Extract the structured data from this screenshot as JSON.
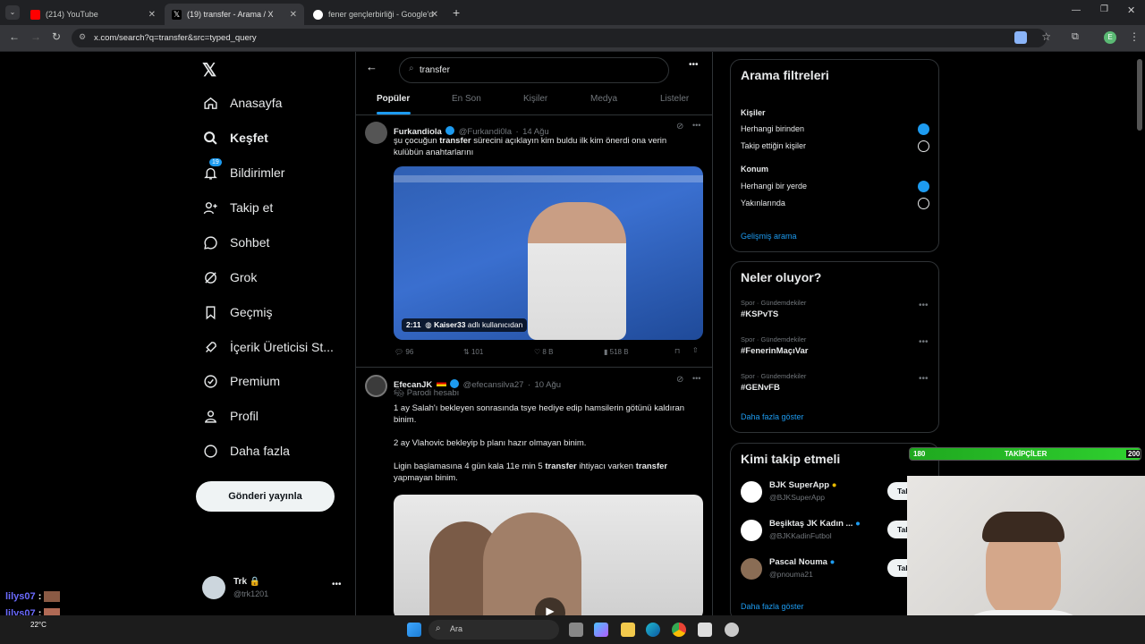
{
  "browser": {
    "tabs": [
      {
        "label": "(214) YouTube",
        "color": "#ff0000"
      },
      {
        "label": "(19) transfer - Arama / X",
        "color": "#ffffff"
      },
      {
        "label": "fener gençlerbirliği - Google'da",
        "color": "#4285f4"
      }
    ],
    "url": "x.com/search?q=transfer&src=typed_query",
    "profile_letter": "E"
  },
  "nav": {
    "items": [
      {
        "label": "Anasayfa",
        "icon": "home-icon"
      },
      {
        "label": "Keşfet",
        "icon": "search-icon"
      },
      {
        "label": "Bildirimler",
        "icon": "bell-icon",
        "badge": "19"
      },
      {
        "label": "Takip et",
        "icon": "add-user-icon"
      },
      {
        "label": "Sohbet",
        "icon": "chat-icon"
      },
      {
        "label": "Grok",
        "icon": "grok-icon"
      },
      {
        "label": "Geçmiş",
        "icon": "bookmark-icon"
      },
      {
        "label": "İçerik Üreticisi St...",
        "icon": "rocket-icon"
      },
      {
        "label": "Premium",
        "icon": "verified-icon"
      },
      {
        "label": "Profil",
        "icon": "person-icon"
      },
      {
        "label": "Daha fazla",
        "icon": "more-circle-icon"
      }
    ],
    "post_button": "Gönderi yayınla",
    "account": {
      "name": "Trk",
      "handle": "@trk1201"
    }
  },
  "search": {
    "query": "transfer",
    "tabs": [
      "Popüler",
      "En Son",
      "Kişiler",
      "Medya",
      "Listeler"
    ],
    "active_tab": "Popüler"
  },
  "tweets": [
    {
      "name": "Furkandiola",
      "handle": "@Furkandi0la",
      "date": "14 Ağu",
      "text_before": "şu çocuğun ",
      "text_bold": "transfer",
      "text_after": " sürecini açıklayın kim buldu ilk kim önerdi ona verin kulübün anahtarlarını",
      "video_duration": "2:11",
      "video_credit_user": "Kaiser33",
      "video_credit_suffix": "adlı kullanıcıdan",
      "replies": "96",
      "reposts": "101",
      "likes": "8 B",
      "views": "518 B"
    },
    {
      "name": "EfecanJK",
      "handle": "@efecansilva27",
      "date": "10 Ağu",
      "subtitle": "Parodi hesabı",
      "p1": "1 ay Salah'ı bekleyen sonrasında tsye hediye edip hamsilerin götünü kaldıran binim.",
      "p2": "2 ay Vlahovic bekleyip b planı hazır olmayan binim.",
      "p3_a": "Ligin başlamasına 4 gün kala 11e min 5 ",
      "p3_b": "transfer",
      "p3_c": " ihtiyacı varken ",
      "p3_d": "transfer",
      "p3_e": " yapmayan binim."
    }
  ],
  "filters": {
    "title": "Arama filtreleri",
    "people_title": "Kişiler",
    "people_options": [
      "Herhangi birinden",
      "Takip ettiğin kişiler"
    ],
    "location_title": "Konum",
    "location_options": [
      "Herhangi bir yerde",
      "Yakınlarında"
    ],
    "advanced": "Gelişmiş arama"
  },
  "trends": {
    "title": "Neler oluyor?",
    "items": [
      {
        "category": "Spor · Gündemdekiler",
        "tag": "#KSPvTS"
      },
      {
        "category": "Spor · Gündemdekiler",
        "tag": "#FenerinMaçıVar"
      },
      {
        "category": "Spor · Gündemdekiler",
        "tag": "#GENvFB"
      }
    ],
    "more": "Daha fazla göster"
  },
  "who_to_follow": {
    "title": "Kimi takip etmeli",
    "items": [
      {
        "name": "BJK SuperApp",
        "handle": "@BJKSuperApp",
        "button": "Taki"
      },
      {
        "name": "Beşiktaş JK Kadın ...",
        "handle": "@BJKKadinFutbol",
        "button": "Taki"
      },
      {
        "name": "Pascal Nouma",
        "handle": "@pnouma21",
        "button": "Taki"
      }
    ],
    "more": "Daha fazla göster"
  },
  "overlay": {
    "follower_bar": {
      "min": "180",
      "label": "TAKİPÇİLER",
      "max": "200"
    },
    "chat": [
      {
        "user": "lilys07",
        "sep": ":"
      },
      {
        "user": "lilys07",
        "sep": ":"
      }
    ],
    "weather": "22°C"
  },
  "taskbar": {
    "search": "Ara"
  }
}
